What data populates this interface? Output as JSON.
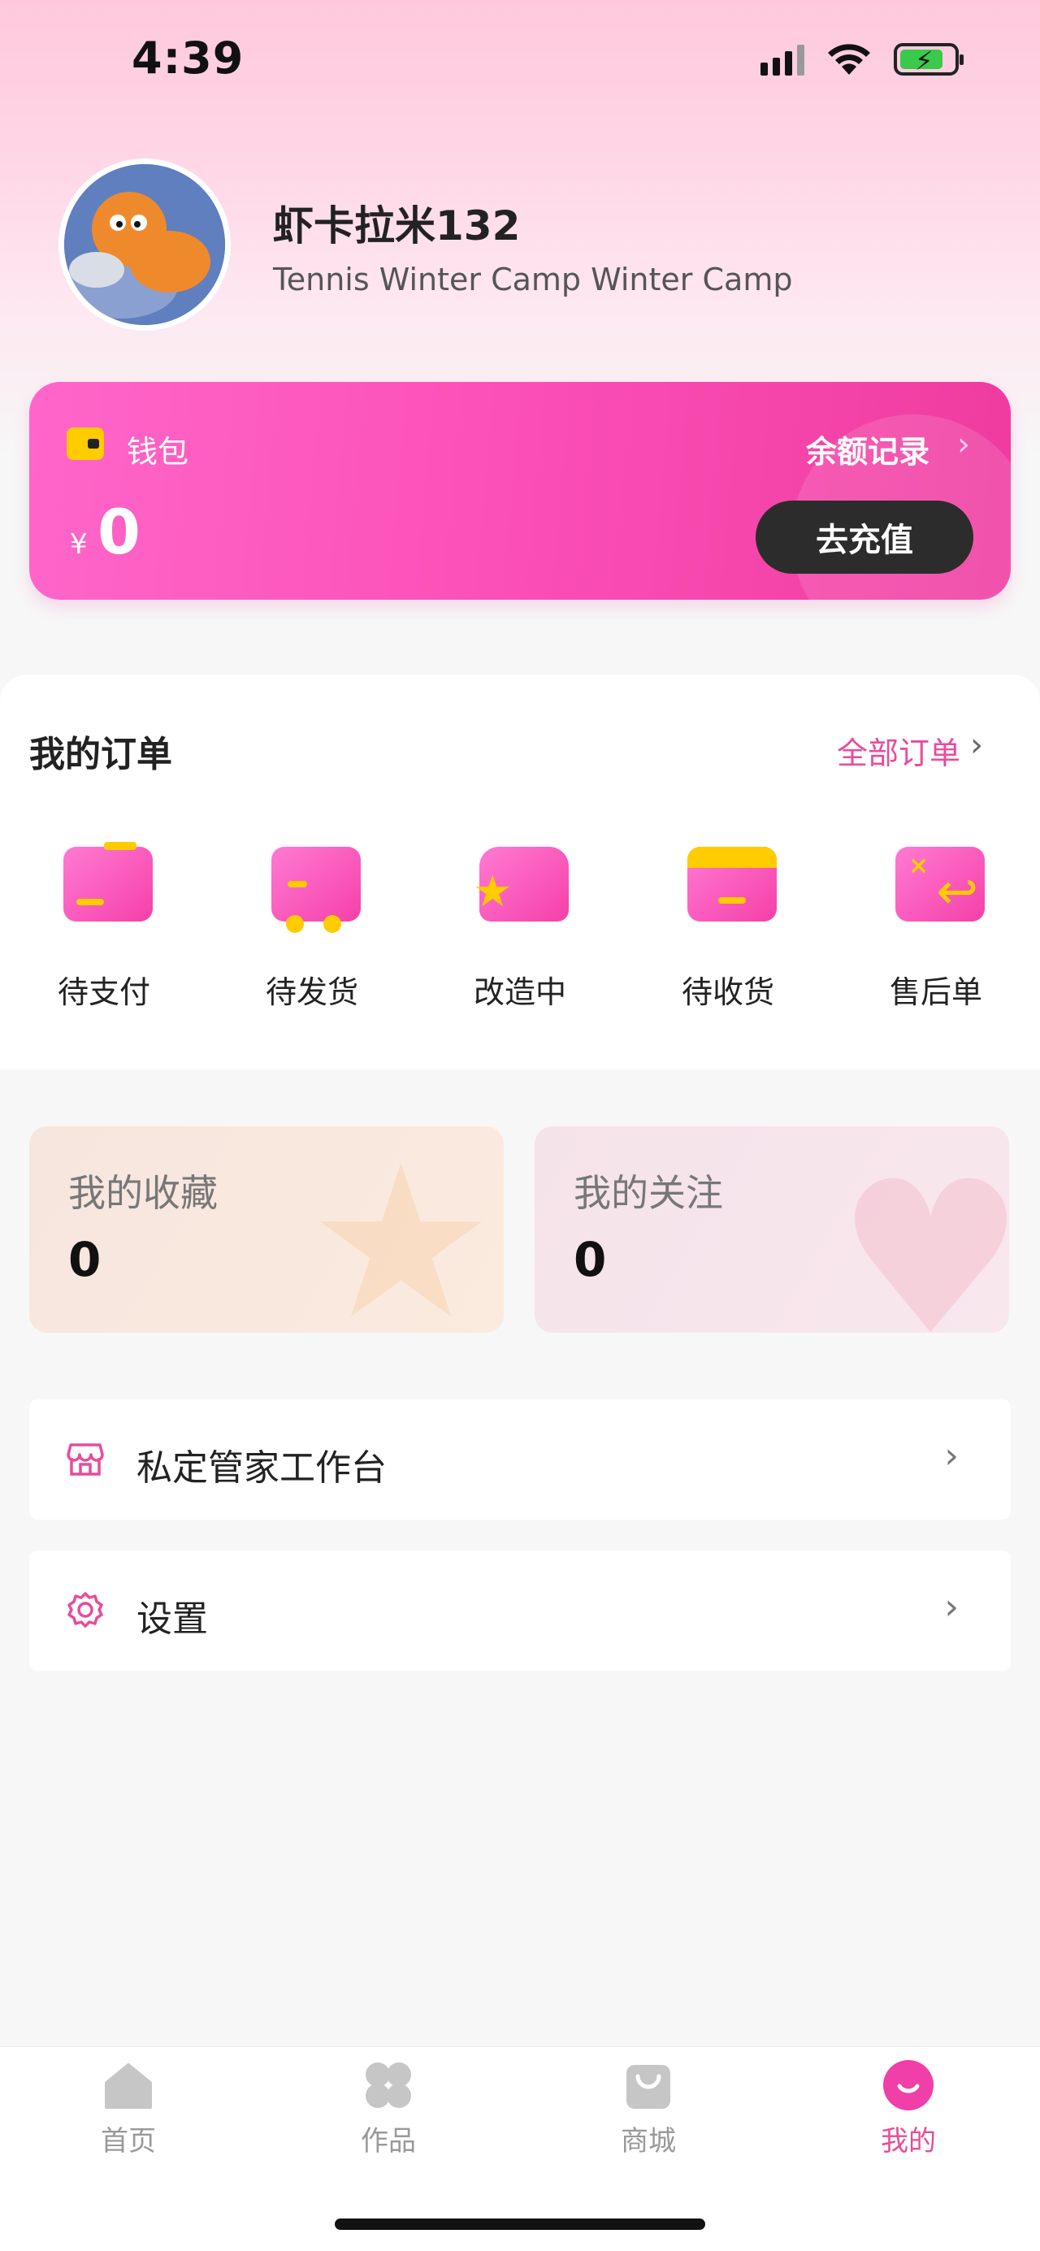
{
  "status_bar": {
    "time": "4:39"
  },
  "profile": {
    "name": "虾卡拉米132",
    "bio": "Tennis Winter Camp Winter Camp"
  },
  "wallet": {
    "label": "钱包",
    "record_link": "余额记录",
    "currency": "¥",
    "balance": "0",
    "recharge_button": "去充值"
  },
  "orders": {
    "title": "我的订单",
    "all_orders": "全部订单",
    "items": [
      {
        "label": "待支付",
        "icon": "wallet-card-icon"
      },
      {
        "label": "待发货",
        "icon": "delivery-truck-icon"
      },
      {
        "label": "改造中",
        "icon": "shirt-star-icon"
      },
      {
        "label": "待收货",
        "icon": "package-box-icon"
      },
      {
        "label": "售后单",
        "icon": "return-arrow-icon"
      }
    ]
  },
  "stats": {
    "favorites": {
      "title": "我的收藏",
      "value": "0"
    },
    "follows": {
      "title": "我的关注",
      "value": "0"
    }
  },
  "menu": {
    "butler": {
      "label": "私定管家工作台",
      "icon": "store-icon"
    },
    "settings": {
      "label": "设置",
      "icon": "gear-icon"
    }
  },
  "tab_bar": {
    "items": [
      {
        "label": "首页",
        "icon": "home-icon"
      },
      {
        "label": "作品",
        "icon": "clover-icon"
      },
      {
        "label": "商城",
        "icon": "shopping-bag-icon"
      },
      {
        "label": "我的",
        "icon": "smile-icon"
      }
    ],
    "active_color": "#e84c9b",
    "inactive_color": "#999999"
  },
  "colors": {
    "accent": "#e84c9b",
    "wallet_gradient_start": "#ff66c9",
    "wallet_gradient_end": "#ef3ba0",
    "recharge_button_bg": "#2c2c2c"
  }
}
